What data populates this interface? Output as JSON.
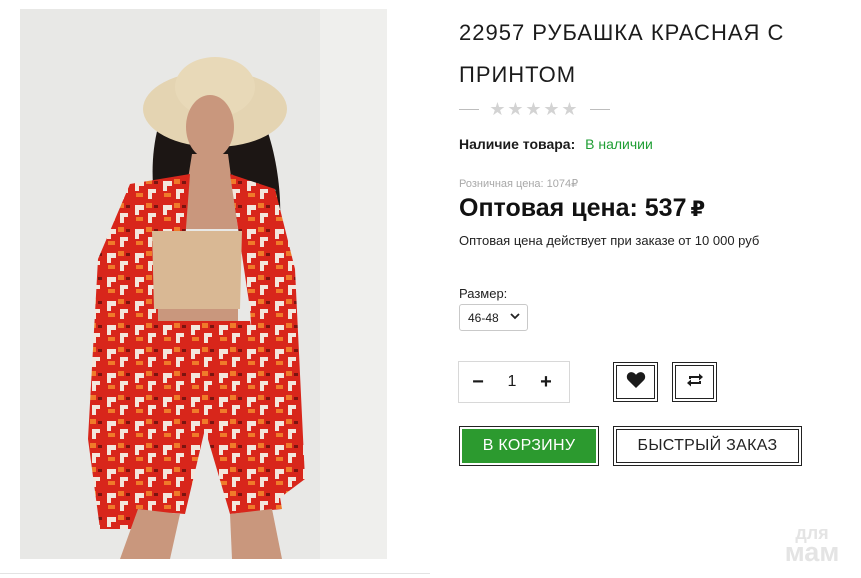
{
  "product": {
    "title": "22957 РУБАШКА КРАСНАЯ С ПРИНТОМ",
    "rating": {
      "stars_filled": 0,
      "stars_total": 5
    },
    "availability": {
      "label": "Наличие товара:",
      "value": "В наличии",
      "color": "#1f9e34"
    },
    "retail_price_text": "Розничная цена: 1074₽",
    "wholesale": {
      "label": "Оптовая цена:",
      "amount": "537",
      "currency": "₽"
    },
    "wholesale_note": "Оптовая цена действует при заказе от 10 000 руб",
    "size": {
      "label": "Размер:",
      "selected": "46-48"
    },
    "quantity": {
      "minus": "−",
      "value": "1",
      "plus": "+"
    },
    "icons": {
      "wishlist": "heart-icon",
      "compare": "repeat-icon",
      "star": "star-icon"
    },
    "buttons": {
      "add_to_cart": "В КОРЗИНУ",
      "quick_order": "БЫСТРЫЙ ЗАКАЗ"
    },
    "colors": {
      "cart_button": "#2c9a2f",
      "star_empty": "#d3d3d3"
    }
  },
  "watermark": {
    "line1": "для",
    "line2": "мам"
  }
}
